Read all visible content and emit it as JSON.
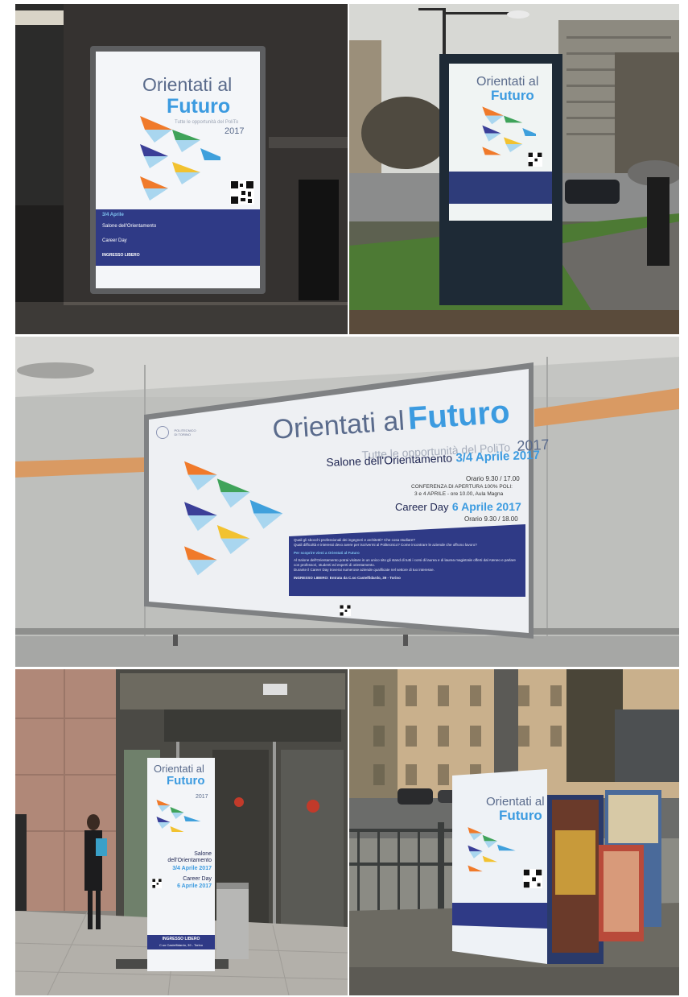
{
  "poster": {
    "title_line1": "Orientati al",
    "title_line2": "Futuro",
    "subtitle": "Tutte le opportunità del PoliTo",
    "year": "2017",
    "event1_name": "Salone dell'Orientamento",
    "event1_dates": "3/4 Aprile 2017",
    "event1_hours": "Orario 9.30 / 17.00",
    "event1_conf_line1": "CONFERENZA DI APERTURA 100% POLI:",
    "event1_conf_line2": "3 e 4 APRILE - ore 10.00, Aula Magna",
    "event2_name": "Career Day",
    "event2_date": "6 Aprile 2017",
    "event2_hours": "Orario 9.30 / 18.00",
    "band_q1": "Quali gli sbocchi professionali dei ingegneri e architetti? Che cosa studiare?",
    "band_q2": "Quali difficoltà e interessi devo avere per iscrivermi al Politecnico? Come incontrare le aziende che offrono lavoro?",
    "band_heading": "Per scoprire vieni a Orientati al Futuro",
    "band_p1": "Al Salone dell'Orientamento potrai visitare in un unico sito gli stand di tutti i corsi di laurea e di laurea magistrale offerti dal Ateneo e parlare con professori, studenti ed esperti di orientamento.",
    "band_p2": "Durante il Career Day troverai numerose aziende qualificate nel settore di tuo interesse.",
    "entry_line": "INGRESSO LIBERO: Entrata da C.so Castelfidardo, 39 - Torino",
    "entry_short": "INGRESSO LIBERO",
    "entry_address": "C.so Castelfidardo, 39 - Torino",
    "short_event1_date": "3/4 Aprile",
    "short_event2_date": "6 Aprile",
    "logo_line1": "POLITECNICO",
    "logo_line2": "DI TORINO"
  },
  "colors": {
    "title_grey": "#5a6b8c",
    "accent_blue": "#3c9be0",
    "dark_blue": "#2f3a86",
    "arrow_orange": "#f07a2a",
    "arrow_green": "#3fa35a",
    "arrow_purple": "#3b3f98",
    "arrow_yellow": "#f2c230",
    "arrow_blue": "#3fa0dc",
    "arrow_light": "#a9d6ef",
    "wall_stripe": "#d99a63"
  }
}
